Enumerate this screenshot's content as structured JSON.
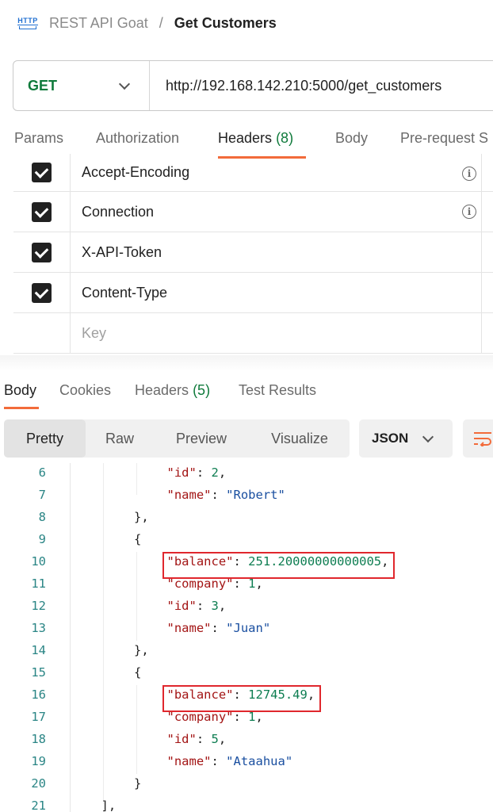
{
  "breadcrumb": {
    "icon": "http-icon",
    "collection": "REST API Goat",
    "separator": "/",
    "request": "Get Customers"
  },
  "request": {
    "method": "GET",
    "url": "http://192.168.142.210:5000/get_customers"
  },
  "request_tabs": [
    {
      "label": "Params"
    },
    {
      "label": "Authorization"
    },
    {
      "label": "Headers",
      "count": "(8)",
      "active": true
    },
    {
      "label": "Body"
    },
    {
      "label": "Pre-request S"
    }
  ],
  "headers_table": {
    "rows": [
      {
        "key": "Accept-Encoding",
        "checked": true,
        "info": true
      },
      {
        "key": "Connection",
        "checked": true,
        "info": true
      },
      {
        "key": "X-API-Token",
        "checked": true,
        "info": false
      },
      {
        "key": "Content-Type",
        "checked": true,
        "info": false
      }
    ],
    "placeholder": "Key"
  },
  "response_tabs": [
    {
      "label": "Body",
      "active": true
    },
    {
      "label": "Cookies"
    },
    {
      "label": "Headers",
      "count": "(5)"
    },
    {
      "label": "Test Results"
    }
  ],
  "view_modes": [
    "Pretty",
    "Raw",
    "Preview",
    "Visualize"
  ],
  "active_view": "Pretty",
  "format": "JSON",
  "code_lines": [
    {
      "n": "6",
      "indent": 3,
      "parts": [
        [
          "k",
          "\"id\""
        ],
        [
          "p",
          ": "
        ],
        [
          "n",
          "2"
        ],
        [
          "p",
          ","
        ]
      ]
    },
    {
      "n": "7",
      "indent": 3,
      "parts": [
        [
          "k",
          "\"name\""
        ],
        [
          "p",
          ": "
        ],
        [
          "s",
          "\"Robert\""
        ]
      ]
    },
    {
      "n": "8",
      "indent": 2,
      "parts": [
        [
          "p",
          "},"
        ]
      ]
    },
    {
      "n": "9",
      "indent": 2,
      "parts": [
        [
          "p",
          "{"
        ]
      ]
    },
    {
      "n": "10",
      "indent": 3,
      "parts": [
        [
          "k",
          "\"balance\""
        ],
        [
          "p",
          ": "
        ],
        [
          "n",
          "251.20000000000005"
        ],
        [
          "p",
          ","
        ]
      ]
    },
    {
      "n": "11",
      "indent": 3,
      "parts": [
        [
          "k",
          "\"company\""
        ],
        [
          "p",
          ": "
        ],
        [
          "n",
          "1"
        ],
        [
          "p",
          ","
        ]
      ]
    },
    {
      "n": "12",
      "indent": 3,
      "parts": [
        [
          "k",
          "\"id\""
        ],
        [
          "p",
          ": "
        ],
        [
          "n",
          "3"
        ],
        [
          "p",
          ","
        ]
      ]
    },
    {
      "n": "13",
      "indent": 3,
      "parts": [
        [
          "k",
          "\"name\""
        ],
        [
          "p",
          ": "
        ],
        [
          "s",
          "\"Juan\""
        ]
      ]
    },
    {
      "n": "14",
      "indent": 2,
      "parts": [
        [
          "p",
          "},"
        ]
      ]
    },
    {
      "n": "15",
      "indent": 2,
      "parts": [
        [
          "p",
          "{"
        ]
      ]
    },
    {
      "n": "16",
      "indent": 3,
      "parts": [
        [
          "k",
          "\"balance\""
        ],
        [
          "p",
          ": "
        ],
        [
          "n",
          "12745.49"
        ],
        [
          "p",
          ","
        ]
      ]
    },
    {
      "n": "17",
      "indent": 3,
      "parts": [
        [
          "k",
          "\"company\""
        ],
        [
          "p",
          ": "
        ],
        [
          "n",
          "1"
        ],
        [
          "p",
          ","
        ]
      ]
    },
    {
      "n": "18",
      "indent": 3,
      "parts": [
        [
          "k",
          "\"id\""
        ],
        [
          "p",
          ": "
        ],
        [
          "n",
          "5"
        ],
        [
          "p",
          ","
        ]
      ]
    },
    {
      "n": "19",
      "indent": 3,
      "parts": [
        [
          "k",
          "\"name\""
        ],
        [
          "p",
          ": "
        ],
        [
          "s",
          "\"Ataahua\""
        ]
      ]
    },
    {
      "n": "20",
      "indent": 2,
      "parts": [
        [
          "p",
          "}"
        ]
      ]
    },
    {
      "n": "21",
      "indent": 1,
      "parts": [
        [
          "p",
          "],"
        ]
      ]
    }
  ],
  "highlighted_lines": [
    "10",
    "16"
  ],
  "colors": {
    "accent": "#f26b3a",
    "method_get": "#0f7a3b",
    "json_key": "#a31515",
    "json_string": "#1a4fa0",
    "json_number": "#0d7d51",
    "highlight_border": "#e0272d"
  }
}
